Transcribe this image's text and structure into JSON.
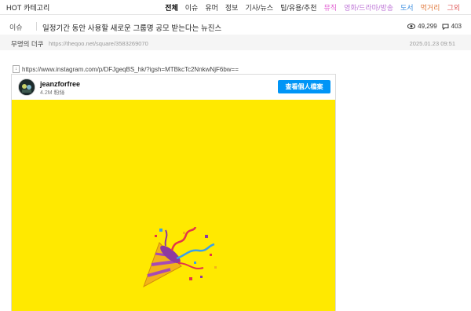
{
  "topbar": {
    "hot_label": "HOT",
    "category_label": "카테고리",
    "categories": [
      {
        "label": "전체",
        "color": "#000000",
        "active": true
      },
      {
        "label": "이슈",
        "color": "#333333"
      },
      {
        "label": "유머",
        "color": "#333333"
      },
      {
        "label": "정보",
        "color": "#333333"
      },
      {
        "label": "기사/뉴스",
        "color": "#333333"
      },
      {
        "label": "팁/유용/추천",
        "color": "#333333"
      },
      {
        "label": "뮤직",
        "color": "#e05bd0"
      },
      {
        "label": "영화/드라마/방송",
        "color": "#c07ad8"
      },
      {
        "label": "도서",
        "color": "#3d8fe0"
      },
      {
        "label": "먹거리",
        "color": "#e07a3d"
      },
      {
        "label": "그외",
        "color": "#e05b5b"
      }
    ]
  },
  "post": {
    "category": "이슈",
    "title": "일정기간 동안 사용할 새로운 그룹명 공모 받는다는 뉴진스",
    "views": "49,299",
    "comments": "403",
    "author": "무명의 더쿠",
    "url": "https://theqoo.net/square/3583269070",
    "date": "2025.01.23 09:51"
  },
  "content": {
    "link_icon": "↓",
    "link_text": "https://www.instagram.com/p/DFJgeqBS_hk/?igsh=MTBkcTc2NnkwNjF6bw=="
  },
  "instagram": {
    "account": "jeanzforfree",
    "followers": "4.2M 粉絲",
    "profile_button": "查看個人檔案",
    "media_color": "#ffe900",
    "media_icon": "party-popper-icon"
  }
}
